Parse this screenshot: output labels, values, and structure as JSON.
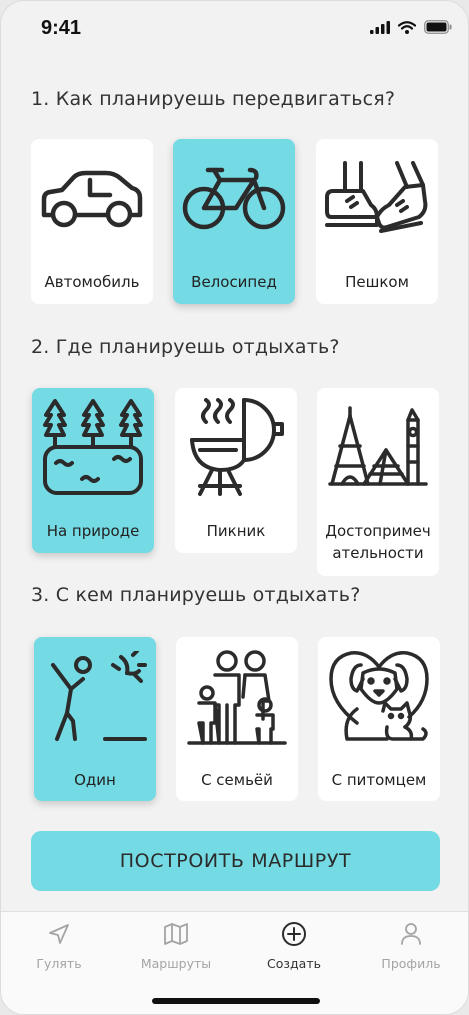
{
  "status": {
    "time": "9:41"
  },
  "sections": [
    {
      "title": "1. Как планируешь передвигаться?",
      "options": [
        {
          "label": "Автомобиль",
          "icon": "car-icon",
          "selected": false
        },
        {
          "label": "Велосипед",
          "icon": "bicycle-icon",
          "selected": true
        },
        {
          "label": "Пешком",
          "icon": "walking-feet-icon",
          "selected": false
        }
      ]
    },
    {
      "title": "2. Где планируешь отдыхать?",
      "options": [
        {
          "label": "На природе",
          "icon": "nature-lake-icon",
          "selected": true
        },
        {
          "label": "Пикник",
          "icon": "grill-icon",
          "selected": false
        },
        {
          "label": "Достопримеч ательности",
          "icon": "landmarks-icon",
          "selected": false
        }
      ]
    },
    {
      "title": "3. С кем планируешь отдыхать?",
      "options": [
        {
          "label": "Один",
          "icon": "solo-person-icon",
          "selected": true
        },
        {
          "label": "С семьёй",
          "icon": "family-icon",
          "selected": false
        },
        {
          "label": "С питомцем",
          "icon": "pets-icon",
          "selected": false
        }
      ]
    }
  ],
  "build_button": "ПОСТРОИТЬ МАРШРУТ",
  "tabbar": [
    {
      "label": "Гулять",
      "icon": "navigation-arrow-icon",
      "active": false
    },
    {
      "label": "Маршруты",
      "icon": "map-icon",
      "active": false
    },
    {
      "label": "Создать",
      "icon": "plus-circle-icon",
      "active": true
    },
    {
      "label": "Профиль",
      "icon": "profile-icon",
      "active": false
    }
  ],
  "colors": {
    "accent": "#74dae3",
    "background": "#f2f2f2",
    "card": "#ffffff",
    "text": "#2b2b2b",
    "inactive_tab": "#a4a4a4"
  }
}
